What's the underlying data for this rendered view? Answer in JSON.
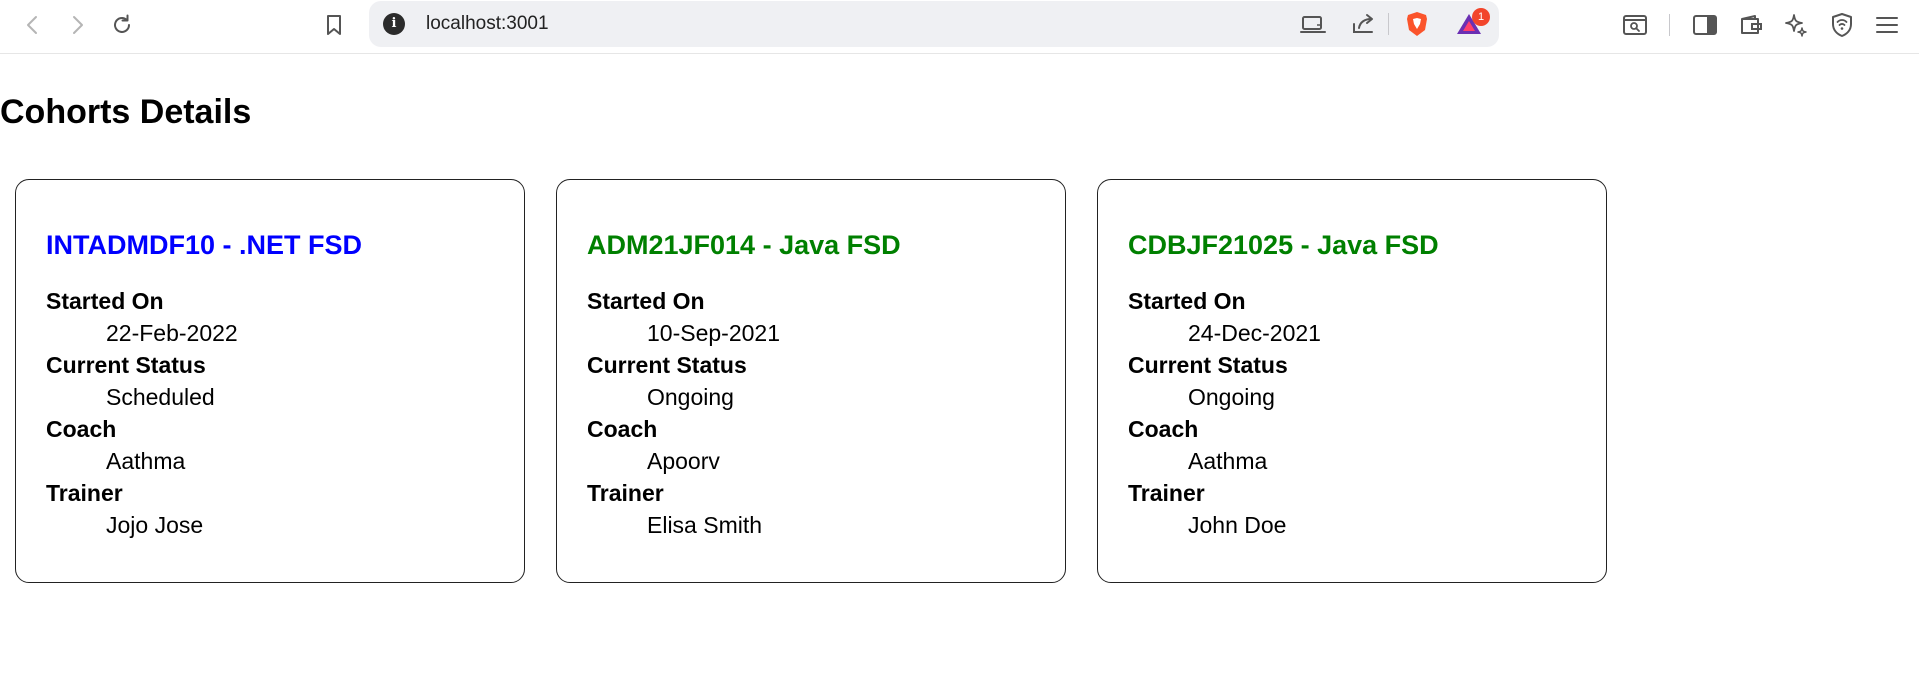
{
  "browser": {
    "url": "localhost:3001",
    "brave_badge_count": "1",
    "icons": [
      "back-icon",
      "forward-icon",
      "reload-icon",
      "bookmark-icon",
      "site-info-icon",
      "cast-icon",
      "share-icon",
      "brave-shields-icon",
      "brave-rewards-icon",
      "tab-search-icon",
      "sidebar-icon",
      "wallet-icon",
      "leo-ai-icon",
      "vpn-icon",
      "menu-icon"
    ]
  },
  "page": {
    "title": "Cohorts Details"
  },
  "colors": {
    "scheduled": "#0000ff",
    "ongoing": "#008000"
  },
  "cohorts": [
    {
      "title": "INTADMDF10 - .NET FSD",
      "status_color": "blue",
      "started_label": "Started On",
      "started_value": "22-Feb-2022",
      "status_label": "Current Status",
      "status_value": "Scheduled",
      "coach_label": "Coach",
      "coach_value": "Aathma",
      "trainer_label": "Trainer",
      "trainer_value": "Jojo Jose"
    },
    {
      "title": "ADM21JF014 - Java FSD",
      "status_color": "green",
      "started_label": "Started On",
      "started_value": "10-Sep-2021",
      "status_label": "Current Status",
      "status_value": "Ongoing",
      "coach_label": "Coach",
      "coach_value": "Apoorv",
      "trainer_label": "Trainer",
      "trainer_value": "Elisa Smith"
    },
    {
      "title": "CDBJF21025 - Java FSD",
      "status_color": "green",
      "started_label": "Started On",
      "started_value": "24-Dec-2021",
      "status_label": "Current Status",
      "status_value": "Ongoing",
      "coach_label": "Coach",
      "coach_value": "Aathma",
      "trainer_label": "Trainer",
      "trainer_value": "John Doe"
    }
  ]
}
